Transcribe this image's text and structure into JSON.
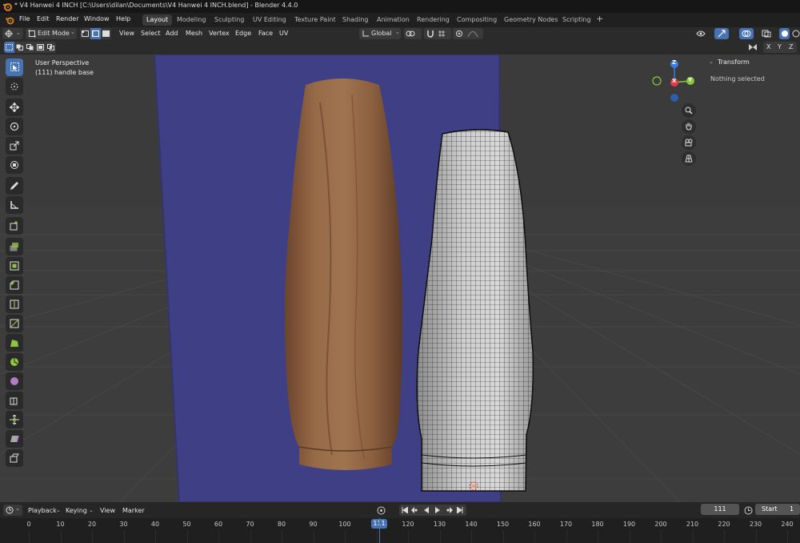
{
  "window": {
    "title": "* V4 Hanwei 4 INCH [C:\\Users\\dilan\\Documents\\V4 Hanwei 4 INCH.blend] - Blender 4.4.0"
  },
  "menu": [
    "File",
    "Edit",
    "Render",
    "Window",
    "Help"
  ],
  "workspaces": [
    "Layout",
    "Modeling",
    "Sculpting",
    "UV Editing",
    "Texture Paint",
    "Shading",
    "Animation",
    "Rendering",
    "Compositing",
    "Geometry Nodes",
    "Scripting"
  ],
  "add_workspace": "+",
  "header": {
    "mode": "Edit Mode",
    "menus": [
      "View",
      "Select",
      "Add",
      "Mesh",
      "Vertex",
      "Edge",
      "Face",
      "UV"
    ],
    "orientation": "Global",
    "mirror_axes": [
      "X",
      "Y",
      "Z"
    ]
  },
  "viewport": {
    "view_name": "User Perspective",
    "object_name": "(111) handle base",
    "gizmo_axes": {
      "z": "Z",
      "x": "X",
      "y": "Y"
    }
  },
  "sidebar": {
    "panel_title": "Transform",
    "message": "Nothing selected"
  },
  "timeline": {
    "menus": [
      "Playback",
      "Keying",
      "View",
      "Marker"
    ],
    "current_frame": "111",
    "start_label": "Start",
    "start_value": "1",
    "ticks": [
      "0",
      "10",
      "20",
      "30",
      "40",
      "50",
      "60",
      "70",
      "80",
      "90",
      "100",
      "110",
      "120",
      "130",
      "140",
      "150",
      "160",
      "170",
      "180",
      "190",
      "200",
      "210",
      "220",
      "230",
      "240"
    ]
  },
  "colors": {
    "accent": "#4772b3",
    "backdrop": "#3f3f86",
    "wood": "#8a5c38",
    "gizmo_x": "#e23d4b",
    "gizmo_y": "#8bc63f",
    "gizmo_z": "#3a7de0"
  }
}
